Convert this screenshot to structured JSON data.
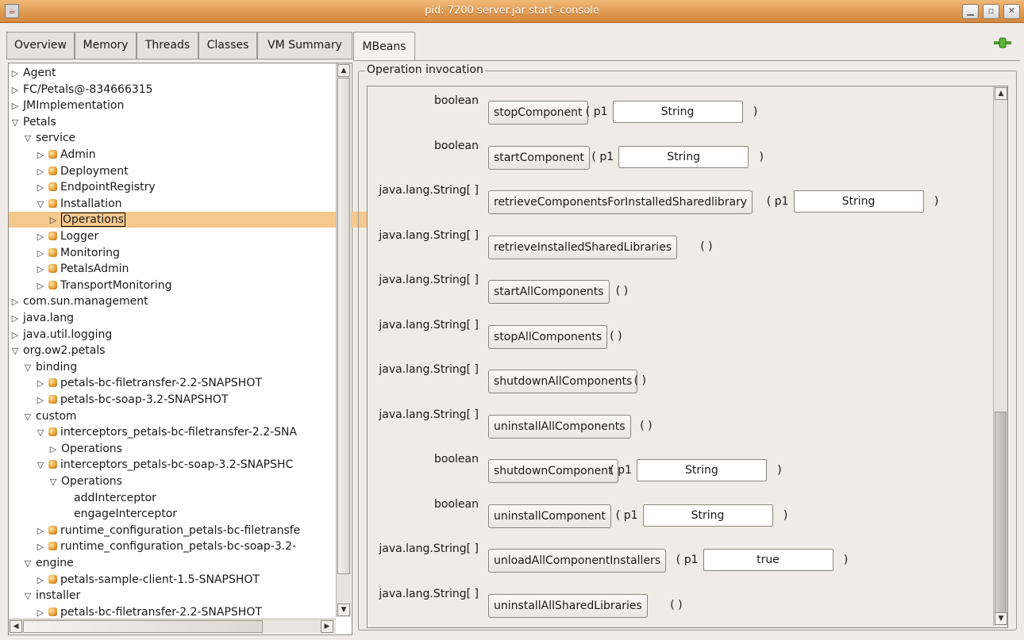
{
  "window": {
    "title": "pid: 7200 server.jar start -console"
  },
  "left_tabs": [
    "Overview",
    "Memory",
    "Threads",
    "Classes",
    "VM Summary"
  ],
  "right_tab": "MBeans",
  "tree": [
    {
      "label": "Agent",
      "depth": 0,
      "toggle": "closed",
      "bean": false
    },
    {
      "label": "FC/Petals@-834666315",
      "depth": 0,
      "toggle": "closed",
      "bean": false
    },
    {
      "label": "JMImplementation",
      "depth": 0,
      "toggle": "closed",
      "bean": false
    },
    {
      "label": "Petals",
      "depth": 0,
      "toggle": "open",
      "bean": false
    },
    {
      "label": "service",
      "depth": 1,
      "toggle": "open",
      "bean": false
    },
    {
      "label": "Admin",
      "depth": 2,
      "toggle": "closed",
      "bean": true
    },
    {
      "label": "Deployment",
      "depth": 2,
      "toggle": "closed",
      "bean": true
    },
    {
      "label": "EndpointRegistry",
      "depth": 2,
      "toggle": "closed",
      "bean": true
    },
    {
      "label": "Installation",
      "depth": 2,
      "toggle": "open",
      "bean": true
    },
    {
      "label": "Operations",
      "depth": 3,
      "toggle": "closed",
      "bean": false,
      "selected": true
    },
    {
      "label": "Logger",
      "depth": 2,
      "toggle": "closed",
      "bean": true
    },
    {
      "label": "Monitoring",
      "depth": 2,
      "toggle": "closed",
      "bean": true
    },
    {
      "label": "PetalsAdmin",
      "depth": 2,
      "toggle": "closed",
      "bean": true
    },
    {
      "label": "TransportMonitoring",
      "depth": 2,
      "toggle": "closed",
      "bean": true
    },
    {
      "label": "com.sun.management",
      "depth": 0,
      "toggle": "closed",
      "bean": false
    },
    {
      "label": "java.lang",
      "depth": 0,
      "toggle": "closed",
      "bean": false
    },
    {
      "label": "java.util.logging",
      "depth": 0,
      "toggle": "closed",
      "bean": false
    },
    {
      "label": "org.ow2.petals",
      "depth": 0,
      "toggle": "open",
      "bean": false
    },
    {
      "label": "binding",
      "depth": 1,
      "toggle": "open",
      "bean": false
    },
    {
      "label": "petals-bc-filetransfer-2.2-SNAPSHOT",
      "depth": 2,
      "toggle": "closed",
      "bean": true
    },
    {
      "label": "petals-bc-soap-3.2-SNAPSHOT",
      "depth": 2,
      "toggle": "closed",
      "bean": true
    },
    {
      "label": "custom",
      "depth": 1,
      "toggle": "open",
      "bean": false
    },
    {
      "label": "interceptors_petals-bc-filetransfer-2.2-SNA",
      "depth": 2,
      "toggle": "open",
      "bean": true
    },
    {
      "label": "Operations",
      "depth": 3,
      "toggle": "closed",
      "bean": false
    },
    {
      "label": "interceptors_petals-bc-soap-3.2-SNAPSHC",
      "depth": 2,
      "toggle": "open",
      "bean": true
    },
    {
      "label": "Operations",
      "depth": 3,
      "toggle": "open",
      "bean": false
    },
    {
      "label": "addInterceptor",
      "depth": 4,
      "toggle": "none",
      "bean": false
    },
    {
      "label": "engageInterceptor",
      "depth": 4,
      "toggle": "none",
      "bean": false
    },
    {
      "label": "runtime_configuration_petals-bc-filetransfe",
      "depth": 2,
      "toggle": "closed",
      "bean": true
    },
    {
      "label": "runtime_configuration_petals-bc-soap-3.2-",
      "depth": 2,
      "toggle": "closed",
      "bean": true
    },
    {
      "label": "engine",
      "depth": 1,
      "toggle": "open",
      "bean": false
    },
    {
      "label": "petals-sample-client-1.5-SNAPSHOT",
      "depth": 2,
      "toggle": "closed",
      "bean": true
    },
    {
      "label": "installer",
      "depth": 1,
      "toggle": "open",
      "bean": false
    },
    {
      "label": "petals-bc-filetransfer-2.2-SNAPSHOT",
      "depth": 2,
      "toggle": "closed",
      "bean": true
    }
  ],
  "panel": {
    "group_title": "Operation invocation",
    "operations": [
      {
        "returns": "boolean",
        "name": "stopComponent",
        "param_label": "p1",
        "param_value": "String"
      },
      {
        "returns": "boolean",
        "name": "startComponent",
        "param_label": "p1",
        "param_value": "String"
      },
      {
        "returns": "java.lang.String[ ]",
        "name": "retrieveComponentsForInstalledSharedlibrary",
        "param_label": "p1",
        "param_value": "String"
      },
      {
        "returns": "java.lang.String[ ]",
        "name": "retrieveInstalledSharedLibraries",
        "param_label": "",
        "param_value": ""
      },
      {
        "returns": "java.lang.String[ ]",
        "name": "startAllComponents",
        "param_label": "",
        "param_value": ""
      },
      {
        "returns": "java.lang.String[ ]",
        "name": "stopAllComponents",
        "param_label": "",
        "param_value": ""
      },
      {
        "returns": "java.lang.String[ ]",
        "name": "shutdownAllComponents",
        "param_label": "",
        "param_value": ""
      },
      {
        "returns": "java.lang.String[ ]",
        "name": "uninstallAllComponents",
        "param_label": "",
        "param_value": ""
      },
      {
        "returns": "boolean",
        "name": "shutdownComponent",
        "param_label": "p1",
        "param_value": "String"
      },
      {
        "returns": "boolean",
        "name": "uninstallComponent",
        "param_label": "p1",
        "param_value": "String"
      },
      {
        "returns": "java.lang.String[ ]",
        "name": "unloadAllComponentInstallers",
        "param_label": "p1",
        "param_value": "true"
      },
      {
        "returns": "java.lang.String[ ]",
        "name": "uninstallAllSharedLibraries",
        "param_label": "",
        "param_value": ""
      }
    ]
  },
  "colors": {
    "title_bar": "#e09a52",
    "selection": "#f5c88e",
    "window_bg": "#efebe7"
  }
}
